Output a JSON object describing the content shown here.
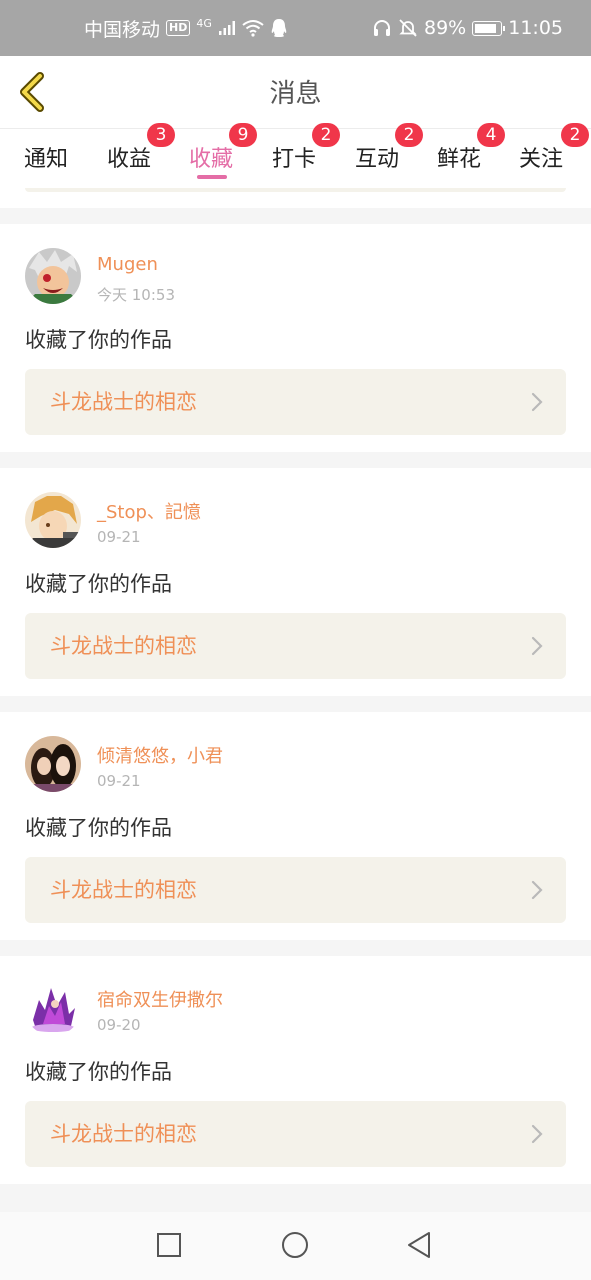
{
  "status_bar": {
    "carrier": "中国移动",
    "hd": "HD",
    "network": "4G",
    "battery": "89%",
    "battery_level": 0.89,
    "time": "11:05"
  },
  "header": {
    "title": "消息"
  },
  "tabs": [
    {
      "label": "通知",
      "badge": ""
    },
    {
      "label": "收益",
      "badge": "3"
    },
    {
      "label": "收藏",
      "badge": "9",
      "active": true
    },
    {
      "label": "打卡",
      "badge": "2"
    },
    {
      "label": "互动",
      "badge": "2"
    },
    {
      "label": "鲜花",
      "badge": "4"
    },
    {
      "label": "关注",
      "badge": "2"
    }
  ],
  "items": [
    {
      "user": "Mugen",
      "time": "今天 10:53",
      "action": "收藏了你的作品",
      "work": "斗龙战士的相恋"
    },
    {
      "user": "_Stop、記憶",
      "time": "09-21",
      "action": "收藏了你的作品",
      "work": "斗龙战士的相恋"
    },
    {
      "user": "倾清悠悠，小君",
      "time": "09-21",
      "action": "收藏了你的作品",
      "work": "斗龙战士的相恋"
    },
    {
      "user": "宿命双生伊撒尔",
      "time": "09-20",
      "action": "收藏了你的作品",
      "work": "斗龙战士的相恋"
    }
  ],
  "colors": {
    "accent_pink": "#e46da6",
    "username_orange": "#ef9057",
    "badge_red": "#f0364a",
    "card_box": "#f4f2ea"
  },
  "nav": {
    "icons": [
      "recent-apps-icon",
      "home-icon",
      "back-icon"
    ]
  }
}
